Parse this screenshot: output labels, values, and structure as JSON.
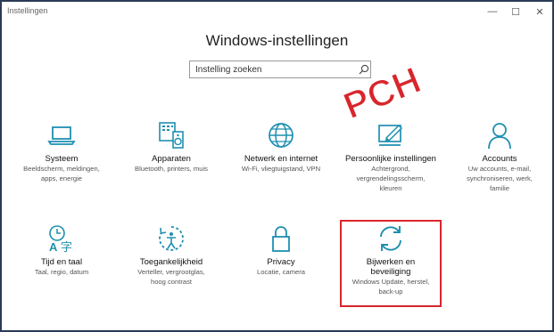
{
  "window": {
    "title": "Instellingen",
    "minimize_glyph": "—",
    "maximize_glyph": "☐",
    "close_glyph": "✕"
  },
  "header": {
    "title": "Windows-instellingen"
  },
  "search": {
    "placeholder": "Instelling zoeken",
    "value": "",
    "icon": "search-icon"
  },
  "watermark": {
    "text": "PCH",
    "color": "#d8262c"
  },
  "accent": "#1f8fb0",
  "highlight_color": "#d8262c",
  "tiles": [
    {
      "title": "Systeem",
      "desc": [
        "Beeldscherm, meldingen,",
        "apps, energie"
      ],
      "icon": "laptop-icon"
    },
    {
      "title": "Apparaten",
      "desc": [
        "Bluetooth, printers, muis"
      ],
      "icon": "devices-icon"
    },
    {
      "title": "Netwerk en internet",
      "desc": [
        "Wi-Fi, vliegtuigstand, VPN"
      ],
      "icon": "globe-icon"
    },
    {
      "title": "Persoonlijke instellingen",
      "desc": [
        "Achtergrond,",
        "vergrendelingsscherm,",
        "kleuren"
      ],
      "icon": "personalization-icon"
    },
    {
      "title": "Accounts",
      "desc": [
        "Uw accounts, e-mail,",
        "synchroniseren, werk,",
        "familie"
      ],
      "icon": "person-icon"
    },
    {
      "title": "Tijd en taal",
      "desc": [
        "Taal, regio, datum"
      ],
      "icon": "time-language-icon"
    },
    {
      "title": "Toegankelijkheid",
      "desc": [
        "Verteller, vergrootglas,",
        "hoog contrast"
      ],
      "icon": "ease-of-access-icon"
    },
    {
      "title": "Privacy",
      "desc": [
        "Locatie, camera"
      ],
      "icon": "lock-icon"
    },
    {
      "title": "Bijwerken en",
      "title2": "beveiliging",
      "desc": [
        "Windows Update, herstel,",
        "back-up"
      ],
      "icon": "sync-icon"
    }
  ]
}
